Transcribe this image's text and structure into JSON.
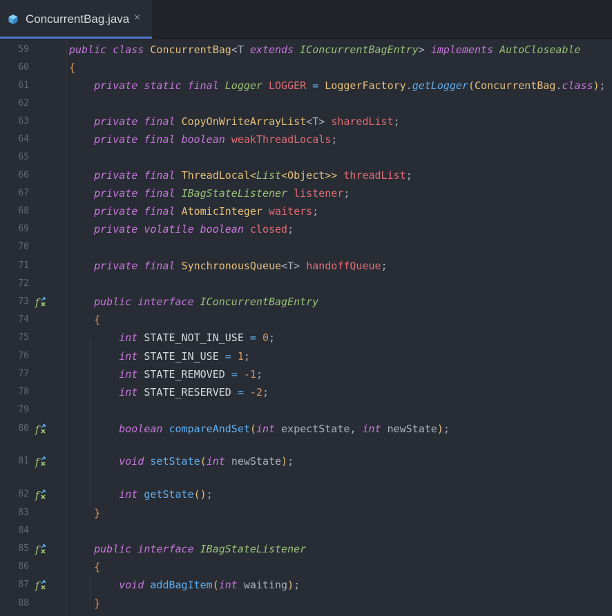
{
  "tab": {
    "title": "ConcurrentBag.java",
    "close": "×",
    "icon": "java-file-icon"
  },
  "colors": {
    "background": "#282c34",
    "keyword": "#c678dd",
    "type": "#e5c07b",
    "field": "#e06c75",
    "method": "#61afef",
    "number": "#d19a66",
    "interface": "#98c379"
  },
  "lines": [
    {
      "num": "59",
      "y": 0,
      "gutter_icon": false,
      "tokens": [
        [
          "public ",
          "kw"
        ],
        [
          "class ",
          "kw"
        ],
        [
          "ConcurrentBag",
          "ty"
        ],
        [
          "<T ",
          "p"
        ],
        [
          "extends ",
          "kw"
        ],
        [
          "IConcurrentBagEntry",
          "iface"
        ],
        [
          "> ",
          "p"
        ],
        [
          "implements ",
          "kw"
        ],
        [
          "AutoCloseable",
          "iface"
        ]
      ]
    },
    {
      "num": "60",
      "gutter_icon": false,
      "tokens": [
        [
          "{",
          "brace"
        ]
      ]
    },
    {
      "num": "61",
      "gutter_icon": false,
      "tokens": [
        [
          "    ",
          "p"
        ],
        [
          "private ",
          "kw"
        ],
        [
          "static ",
          "kw"
        ],
        [
          "final ",
          "kw"
        ],
        [
          "Logger ",
          "iface"
        ],
        [
          "LOGGER ",
          "fld"
        ],
        [
          "= ",
          "fn"
        ],
        [
          "LoggerFactory",
          "ty"
        ],
        [
          ".",
          "p"
        ],
        [
          "getLogger",
          "fni"
        ],
        [
          "(",
          "br"
        ],
        [
          "ConcurrentBag",
          "ty"
        ],
        [
          ".",
          "p"
        ],
        [
          "class",
          "kw"
        ],
        [
          ")",
          "br"
        ],
        [
          ";",
          "p"
        ]
      ]
    },
    {
      "num": "62",
      "gutter_icon": false,
      "tokens": []
    },
    {
      "num": "63",
      "gutter_icon": false,
      "tokens": [
        [
          "    ",
          "p"
        ],
        [
          "private ",
          "kw"
        ],
        [
          "final ",
          "kw"
        ],
        [
          "CopyOnWriteArrayList",
          "ty"
        ],
        [
          "<T> ",
          "p"
        ],
        [
          "sharedList",
          "fld"
        ],
        [
          ";",
          "p"
        ]
      ]
    },
    {
      "num": "64",
      "gutter_icon": false,
      "tokens": [
        [
          "    ",
          "p"
        ],
        [
          "private ",
          "kw"
        ],
        [
          "final ",
          "kw"
        ],
        [
          "boolean ",
          "kw"
        ],
        [
          "weakThreadLocals",
          "fld"
        ],
        [
          ";",
          "p"
        ]
      ]
    },
    {
      "num": "65",
      "gutter_icon": false,
      "tokens": []
    },
    {
      "num": "66",
      "gutter_icon": false,
      "tokens": [
        [
          "    ",
          "p"
        ],
        [
          "private ",
          "kw"
        ],
        [
          "final ",
          "kw"
        ],
        [
          "ThreadLocal",
          "ty"
        ],
        [
          "<",
          "br"
        ],
        [
          "List",
          "iface"
        ],
        [
          "<",
          "br"
        ],
        [
          "Object",
          "ty"
        ],
        [
          ">> ",
          "br"
        ],
        [
          "threadList",
          "fld"
        ],
        [
          ";",
          "p"
        ]
      ]
    },
    {
      "num": "67",
      "gutter_icon": false,
      "tokens": [
        [
          "    ",
          "p"
        ],
        [
          "private ",
          "kw"
        ],
        [
          "final ",
          "kw"
        ],
        [
          "IBagStateListener ",
          "iface"
        ],
        [
          "listener",
          "fld"
        ],
        [
          ";",
          "p"
        ]
      ]
    },
    {
      "num": "68",
      "gutter_icon": false,
      "tokens": [
        [
          "    ",
          "p"
        ],
        [
          "private ",
          "kw"
        ],
        [
          "final ",
          "kw"
        ],
        [
          "AtomicInteger ",
          "ty"
        ],
        [
          "waiters",
          "fld"
        ],
        [
          ";",
          "p"
        ]
      ]
    },
    {
      "num": "69",
      "gutter_icon": false,
      "tokens": [
        [
          "    ",
          "p"
        ],
        [
          "private ",
          "kw"
        ],
        [
          "volatile ",
          "kw"
        ],
        [
          "boolean ",
          "kw"
        ],
        [
          "closed",
          "fld"
        ],
        [
          ";",
          "p"
        ]
      ]
    },
    {
      "num": "70",
      "gutter_icon": false,
      "tokens": []
    },
    {
      "num": "71",
      "gutter_icon": false,
      "tokens": [
        [
          "    ",
          "p"
        ],
        [
          "private ",
          "kw"
        ],
        [
          "final ",
          "kw"
        ],
        [
          "SynchronousQueue",
          "ty"
        ],
        [
          "<T> ",
          "p"
        ],
        [
          "handoffQueue",
          "fld"
        ],
        [
          ";",
          "p"
        ]
      ]
    },
    {
      "num": "72",
      "gutter_icon": false,
      "tokens": []
    },
    {
      "num": "73",
      "gutter_icon": true,
      "tokens": [
        [
          "    ",
          "p"
        ],
        [
          "public ",
          "kw"
        ],
        [
          "interface ",
          "kw"
        ],
        [
          "IConcurrentBagEntry",
          "iface"
        ]
      ]
    },
    {
      "num": "74",
      "gutter_icon": false,
      "tokens": [
        [
          "    ",
          "p"
        ],
        [
          "{",
          "brace"
        ]
      ]
    },
    {
      "num": "75",
      "gutter_icon": false,
      "tokens": [
        [
          "        ",
          "p"
        ],
        [
          "int ",
          "kw"
        ],
        [
          "STATE_NOT_IN_USE ",
          "const"
        ],
        [
          "= ",
          "fn"
        ],
        [
          "0",
          "nm"
        ],
        [
          ";",
          "p"
        ]
      ]
    },
    {
      "num": "76",
      "gutter_icon": false,
      "tokens": [
        [
          "        ",
          "p"
        ],
        [
          "int ",
          "kw"
        ],
        [
          "STATE_IN_USE ",
          "const"
        ],
        [
          "= ",
          "fn"
        ],
        [
          "1",
          "nm"
        ],
        [
          ";",
          "p"
        ]
      ]
    },
    {
      "num": "77",
      "gutter_icon": false,
      "tokens": [
        [
          "        ",
          "p"
        ],
        [
          "int ",
          "kw"
        ],
        [
          "STATE_REMOVED ",
          "const"
        ],
        [
          "= ",
          "fn"
        ],
        [
          "-1",
          "nm"
        ],
        [
          ";",
          "p"
        ]
      ]
    },
    {
      "num": "78",
      "gutter_icon": false,
      "tokens": [
        [
          "        ",
          "p"
        ],
        [
          "int ",
          "kw"
        ],
        [
          "STATE_RESERVED ",
          "const"
        ],
        [
          "= ",
          "fn"
        ],
        [
          "-2",
          "nm"
        ],
        [
          ";",
          "p"
        ]
      ]
    },
    {
      "num": "79",
      "gutter_icon": false,
      "tokens": []
    },
    {
      "num": "80",
      "gutter_icon": true,
      "tokens": [
        [
          "        ",
          "p"
        ],
        [
          "boolean ",
          "kw"
        ],
        [
          "compareAndSet",
          "fn"
        ],
        [
          "(",
          "br"
        ],
        [
          "int ",
          "kw"
        ],
        [
          "expectState, ",
          "p"
        ],
        [
          "int ",
          "kw"
        ],
        [
          "newState",
          "p"
        ],
        [
          ")",
          "br"
        ],
        [
          ";",
          "p"
        ]
      ]
    },
    {
      "num": "81",
      "gutter_icon": true,
      "tokens": [
        [
          "        ",
          "p"
        ],
        [
          "void ",
          "kw"
        ],
        [
          "setState",
          "fn"
        ],
        [
          "(",
          "br"
        ],
        [
          "int ",
          "kw"
        ],
        [
          "newState",
          "p"
        ],
        [
          ")",
          "br"
        ],
        [
          ";",
          "p"
        ]
      ]
    },
    {
      "num": "82",
      "gutter_icon": true,
      "tokens": [
        [
          "        ",
          "p"
        ],
        [
          "int ",
          "kw"
        ],
        [
          "getState",
          "fn"
        ],
        [
          "()",
          "br"
        ],
        [
          ";",
          "p"
        ]
      ]
    },
    {
      "num": "83",
      "gutter_icon": false,
      "tokens": [
        [
          "    ",
          "p"
        ],
        [
          "}",
          "brace"
        ]
      ]
    },
    {
      "num": "84",
      "gutter_icon": false,
      "tokens": []
    },
    {
      "num": "85",
      "gutter_icon": true,
      "tokens": [
        [
          "    ",
          "p"
        ],
        [
          "public ",
          "kw"
        ],
        [
          "interface ",
          "kw"
        ],
        [
          "IBagStateListener",
          "iface"
        ]
      ]
    },
    {
      "num": "86",
      "gutter_icon": false,
      "tokens": [
        [
          "    ",
          "p"
        ],
        [
          "{",
          "brace"
        ]
      ]
    },
    {
      "num": "87",
      "gutter_icon": true,
      "tokens": [
        [
          "        ",
          "p"
        ],
        [
          "void ",
          "kw"
        ],
        [
          "addBagItem",
          "fn"
        ],
        [
          "(",
          "br"
        ],
        [
          "int ",
          "kw"
        ],
        [
          "waiting",
          "p"
        ],
        [
          ")",
          "br"
        ],
        [
          ";",
          "p"
        ]
      ]
    },
    {
      "num": "88",
      "gutter_icon": false,
      "tokens": [
        [
          "    ",
          "p"
        ],
        [
          "}",
          "brace"
        ]
      ]
    }
  ]
}
